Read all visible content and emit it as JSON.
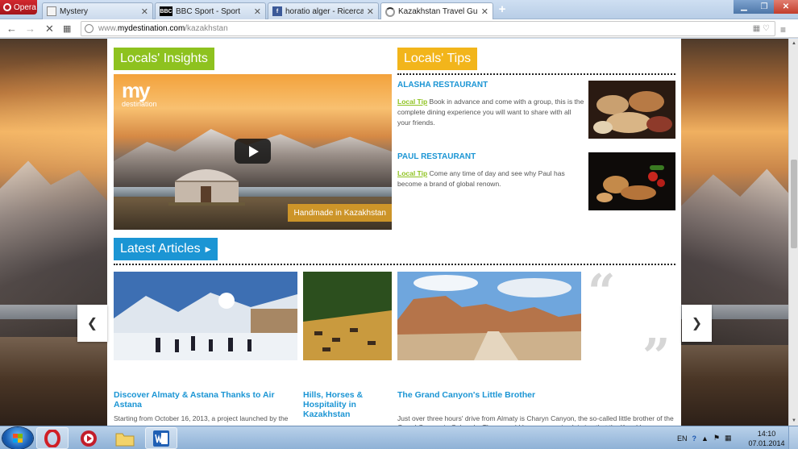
{
  "browser": {
    "menu_label": "Opera",
    "tabs": [
      {
        "title": "Mystery",
        "active": false
      },
      {
        "title": "BBC Sport - Sport",
        "active": false
      },
      {
        "title": "horatio alger - Ricerca di F",
        "active": false
      },
      {
        "title": "Kazakhstan Travel Guide -",
        "active": true
      }
    ],
    "new_tab": "+",
    "url": {
      "host": "www.",
      "domain": "mydestination.com",
      "path": "/kazakhstan"
    }
  },
  "page": {
    "locals_insights": {
      "label": "Locals' Insights"
    },
    "video": {
      "logo_my": "my",
      "logo_destination": "destination",
      "caption": "Handmade in Kazakhstan"
    },
    "locals_tips": {
      "label": "Locals' Tips",
      "items": [
        {
          "title": "ALASHA RESTAURANT",
          "tag": "Local Tip",
          "text": "Book in advance and come with a group, this is the complete dining experience you will want to share with all your friends."
        },
        {
          "title": "PAUL RESTAURANT",
          "tag": "Local Tip",
          "text": "Come any time of day and see why Paul has become a brand of global renown."
        }
      ]
    },
    "latest_articles": {
      "label": "Latest Articles",
      "items": [
        {
          "title": "Discover Almaty & Astana Thanks to Air Astana",
          "excerpt": "Starting from October 16, 2013, a project launched by the"
        },
        {
          "title": "Hills, Horses & Hospitality in Kazakhstan",
          "excerpt": ""
        },
        {
          "title": "The Grand Canyon's Little Brother",
          "excerpt": "Just over three hours' drive from Almaty is Charyn Canyon, the so-called little brother of the Grand Canyon in Colorado. There would be no sense in claiming that the Kazakh"
        }
      ]
    }
  },
  "taskbar": {
    "apps": [
      "opera",
      "media",
      "explorer",
      "word"
    ],
    "language": "EN",
    "time": "14:10",
    "date": "07.01.2014"
  }
}
